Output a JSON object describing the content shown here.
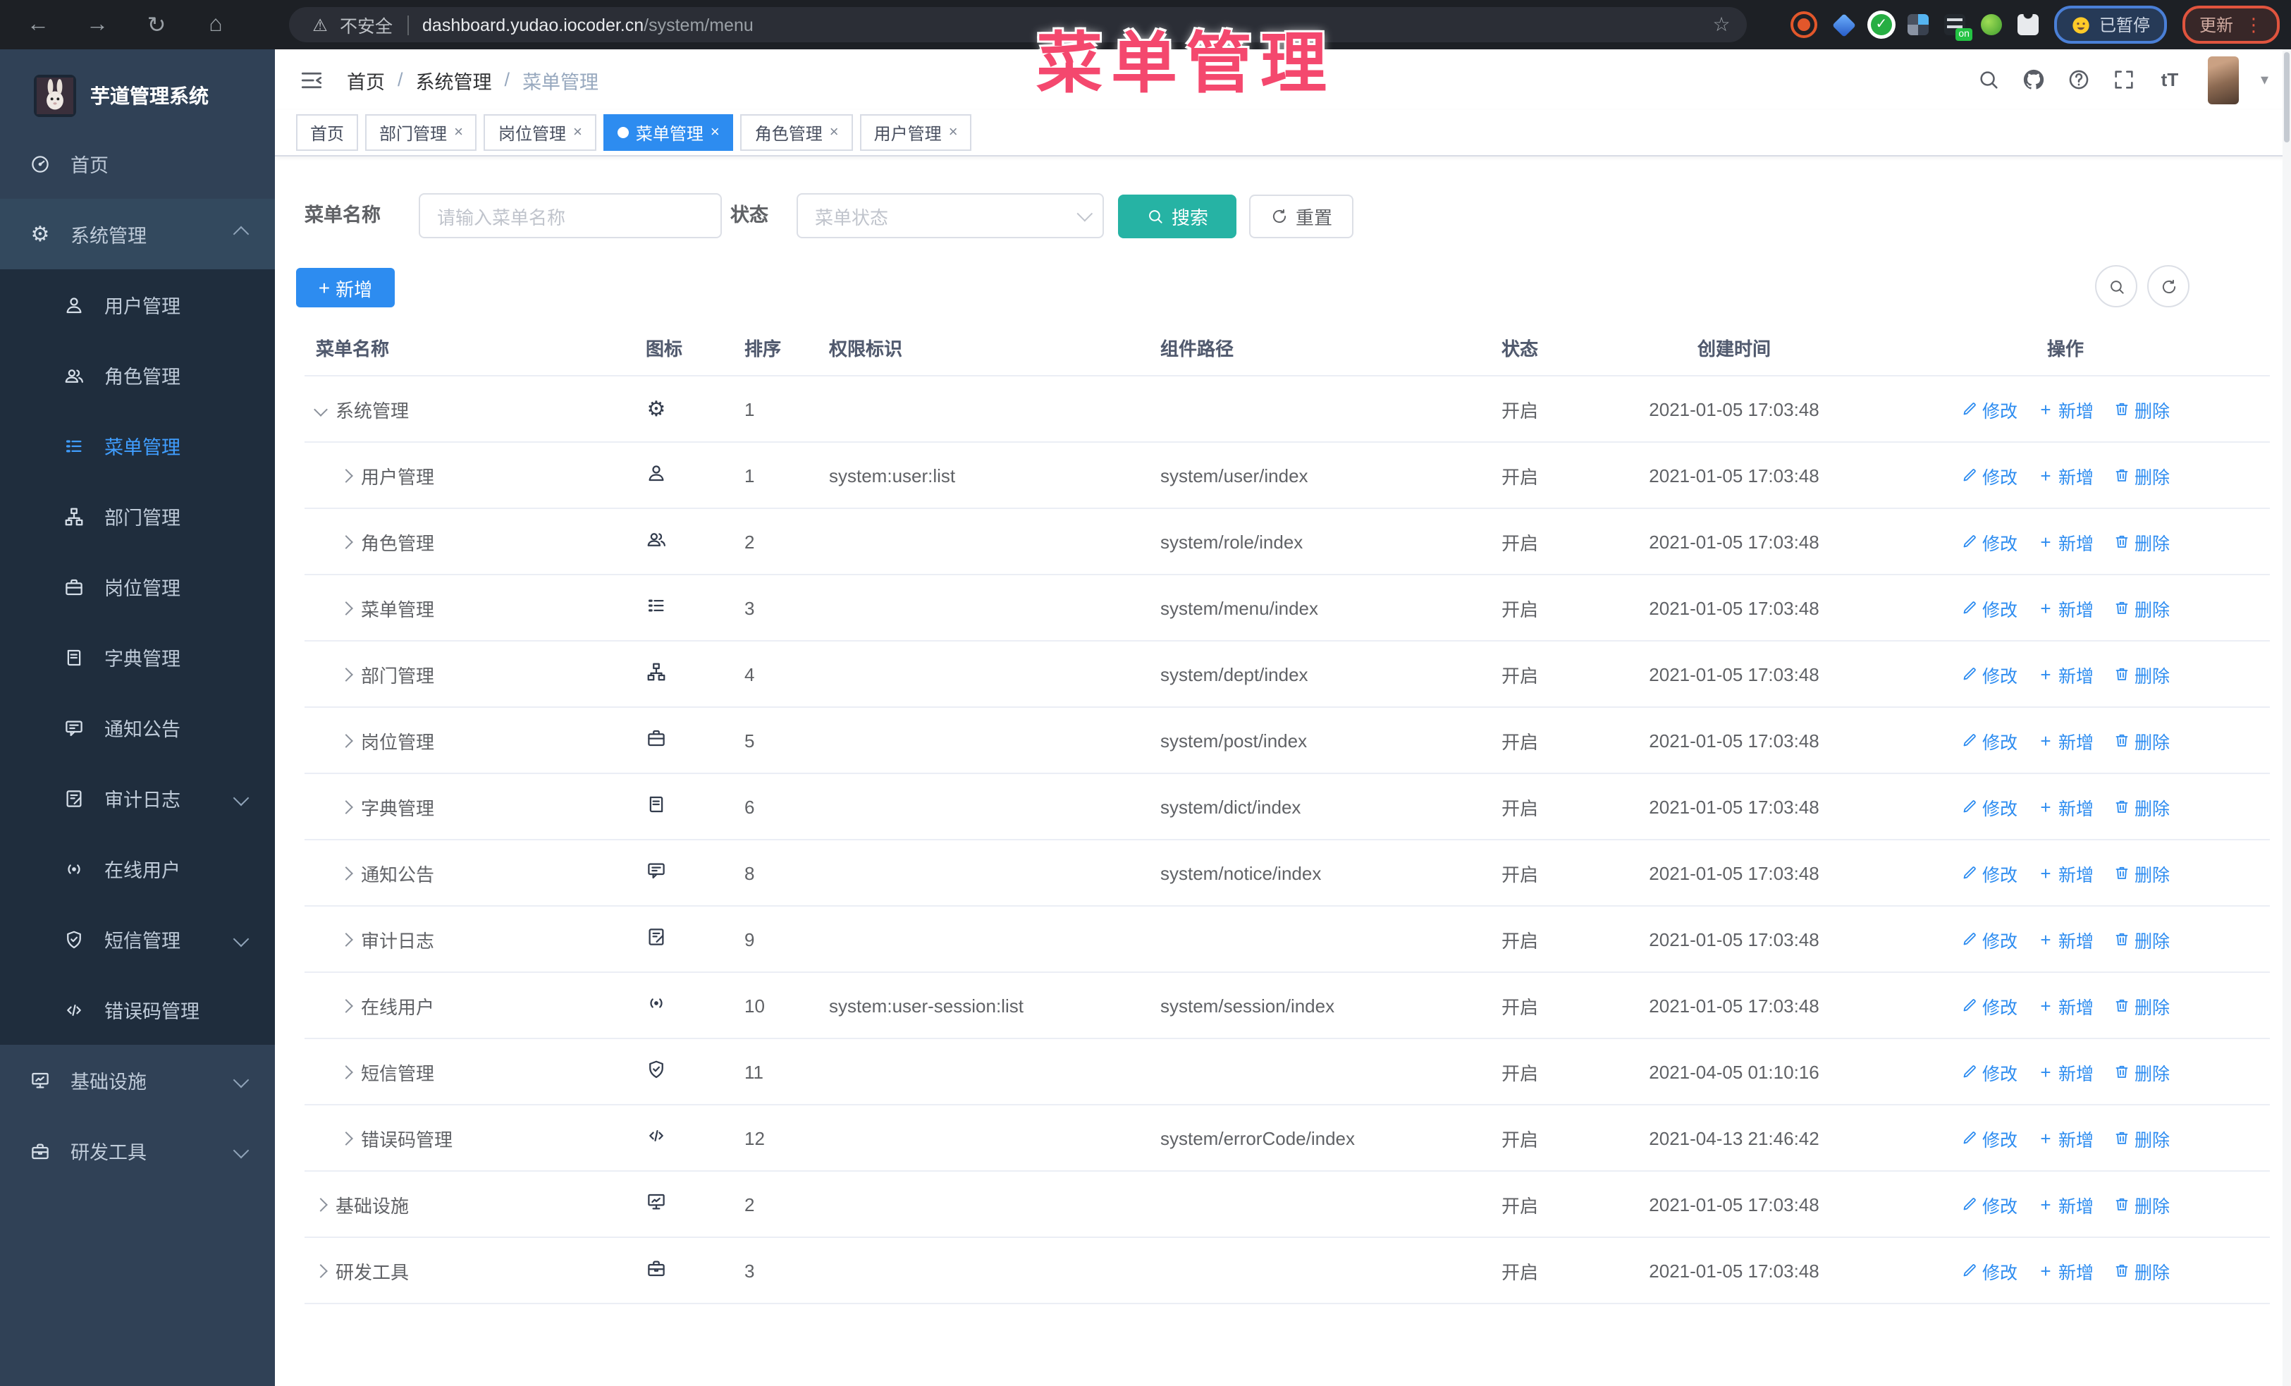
{
  "colors": {
    "primary": "#2d8cf0",
    "link": "#2d8cf0",
    "search-btn": "#26b3a4",
    "sidebar-bg": "#304156",
    "submenu-bg": "#1f2d3d",
    "overlay-pink": "#f4486e"
  },
  "overlay_title": "菜单管理",
  "browser": {
    "nav_icons": [
      "back-icon",
      "forward-icon",
      "reload-icon",
      "home-icon"
    ],
    "security_label": "不安全",
    "url_domain": "dashboard.yudao.iocoder.cn",
    "url_path": "/system/menu",
    "star_icon": "star-icon",
    "extensions": [
      "target",
      "gem",
      "check",
      "grid",
      "bars",
      "leaf",
      "puzzle"
    ],
    "paused_label": "已暂停",
    "update_label": "更新"
  },
  "sidebar": {
    "logo_title": "芋道管理系统",
    "items": [
      {
        "label": "首页",
        "icon": "dashboard-icon",
        "level": 1
      },
      {
        "label": "系统管理",
        "icon": "gear-icon",
        "level": 1,
        "caret": "up",
        "open": true
      },
      {
        "label": "用户管理",
        "icon": "user-icon",
        "level": 2
      },
      {
        "label": "角色管理",
        "icon": "users-icon",
        "level": 2
      },
      {
        "label": "菜单管理",
        "icon": "menu-list-icon",
        "level": 2,
        "active": true
      },
      {
        "label": "部门管理",
        "icon": "org-tree-icon",
        "level": 2
      },
      {
        "label": "岗位管理",
        "icon": "suitcase-icon",
        "level": 2
      },
      {
        "label": "字典管理",
        "icon": "dict-book-icon",
        "level": 2
      },
      {
        "label": "通知公告",
        "icon": "notice-icon",
        "level": 2
      },
      {
        "label": "审计日志",
        "icon": "audit-log-icon",
        "level": 2,
        "caret": "down"
      },
      {
        "label": "在线用户",
        "icon": "online-user-icon",
        "level": 2
      },
      {
        "label": "短信管理",
        "icon": "sms-shield-icon",
        "level": 2,
        "caret": "down"
      },
      {
        "label": "错误码管理",
        "icon": "error-code-icon",
        "level": 2
      },
      {
        "label": "基础设施",
        "icon": "monitor-icon",
        "level": 1,
        "caret": "down"
      },
      {
        "label": "研发工具",
        "icon": "toolbox-icon",
        "level": 1,
        "caret": "down"
      }
    ]
  },
  "header": {
    "breadcrumb": [
      "首页",
      "系统管理",
      "菜单管理"
    ],
    "separator": "/",
    "icons": [
      "search-icon",
      "github-icon",
      "question-icon",
      "fullscreen-icon",
      "fontsize-icon"
    ]
  },
  "tabs": [
    {
      "label": "首页",
      "closable": false,
      "active": false
    },
    {
      "label": "部门管理",
      "closable": true,
      "active": false
    },
    {
      "label": "岗位管理",
      "closable": true,
      "active": false
    },
    {
      "label": "菜单管理",
      "closable": true,
      "active": true
    },
    {
      "label": "角色管理",
      "closable": true,
      "active": false
    },
    {
      "label": "用户管理",
      "closable": true,
      "active": false
    }
  ],
  "filters": {
    "name_label": "菜单名称",
    "name_placeholder": "请输入菜单名称",
    "status_label": "状态",
    "status_placeholder": "菜单状态",
    "search_label": "搜索",
    "reset_label": "重置"
  },
  "toolbar": {
    "add_label": "新增"
  },
  "table": {
    "columns": [
      "菜单名称",
      "图标",
      "排序",
      "权限标识",
      "组件路径",
      "状态",
      "创建时间",
      "操作"
    ],
    "actions": [
      {
        "key": "edit",
        "label": "修改",
        "icon": "edit-icon"
      },
      {
        "key": "add",
        "label": "新增",
        "icon": "plus-icon"
      },
      {
        "key": "delete",
        "label": "删除",
        "icon": "trash-icon"
      }
    ],
    "rows": [
      {
        "name": "系统管理",
        "icon": "gear-icon",
        "indent": 0,
        "caret": "expanded",
        "sort": "1",
        "perm": "",
        "path": "",
        "status": "开启",
        "time": "2021-01-05 17:03:48"
      },
      {
        "name": "用户管理",
        "icon": "user-icon",
        "indent": 1,
        "caret": "collapsed",
        "sort": "1",
        "perm": "system:user:list",
        "path": "system/user/index",
        "status": "开启",
        "time": "2021-01-05 17:03:48"
      },
      {
        "name": "角色管理",
        "icon": "users-icon",
        "indent": 1,
        "caret": "collapsed",
        "sort": "2",
        "perm": "",
        "path": "system/role/index",
        "status": "开启",
        "time": "2021-01-05 17:03:48"
      },
      {
        "name": "菜单管理",
        "icon": "menu-list-icon",
        "indent": 1,
        "caret": "collapsed",
        "sort": "3",
        "perm": "",
        "path": "system/menu/index",
        "status": "开启",
        "time": "2021-01-05 17:03:48"
      },
      {
        "name": "部门管理",
        "icon": "org-tree-icon",
        "indent": 1,
        "caret": "collapsed",
        "sort": "4",
        "perm": "",
        "path": "system/dept/index",
        "status": "开启",
        "time": "2021-01-05 17:03:48"
      },
      {
        "name": "岗位管理",
        "icon": "suitcase-icon",
        "indent": 1,
        "caret": "collapsed",
        "sort": "5",
        "perm": "",
        "path": "system/post/index",
        "status": "开启",
        "time": "2021-01-05 17:03:48"
      },
      {
        "name": "字典管理",
        "icon": "dict-book-icon",
        "indent": 1,
        "caret": "collapsed",
        "sort": "6",
        "perm": "",
        "path": "system/dict/index",
        "status": "开启",
        "time": "2021-01-05 17:03:48"
      },
      {
        "name": "通知公告",
        "icon": "notice-icon",
        "indent": 1,
        "caret": "collapsed",
        "sort": "8",
        "perm": "",
        "path": "system/notice/index",
        "status": "开启",
        "time": "2021-01-05 17:03:48"
      },
      {
        "name": "审计日志",
        "icon": "audit-log-icon",
        "indent": 1,
        "caret": "collapsed",
        "sort": "9",
        "perm": "",
        "path": "",
        "status": "开启",
        "time": "2021-01-05 17:03:48"
      },
      {
        "name": "在线用户",
        "icon": "online-user-icon",
        "indent": 1,
        "caret": "collapsed",
        "sort": "10",
        "perm": "system:user-session:list",
        "path": "system/session/index",
        "status": "开启",
        "time": "2021-01-05 17:03:48"
      },
      {
        "name": "短信管理",
        "icon": "sms-shield-icon",
        "indent": 1,
        "caret": "collapsed",
        "sort": "11",
        "perm": "",
        "path": "",
        "status": "开启",
        "time": "2021-04-05 01:10:16"
      },
      {
        "name": "错误码管理",
        "icon": "error-code-icon",
        "indent": 1,
        "caret": "collapsed",
        "sort": "12",
        "perm": "",
        "path": "system/errorCode/index",
        "status": "开启",
        "time": "2021-04-13 21:46:42"
      },
      {
        "name": "基础设施",
        "icon": "monitor-icon",
        "indent": 0,
        "caret": "collapsed",
        "sort": "2",
        "perm": "",
        "path": "",
        "status": "开启",
        "time": "2021-01-05 17:03:48"
      },
      {
        "name": "研发工具",
        "icon": "toolbox-icon",
        "indent": 0,
        "caret": "collapsed",
        "sort": "3",
        "perm": "",
        "path": "",
        "status": "开启",
        "time": "2021-01-05 17:03:48"
      }
    ]
  }
}
